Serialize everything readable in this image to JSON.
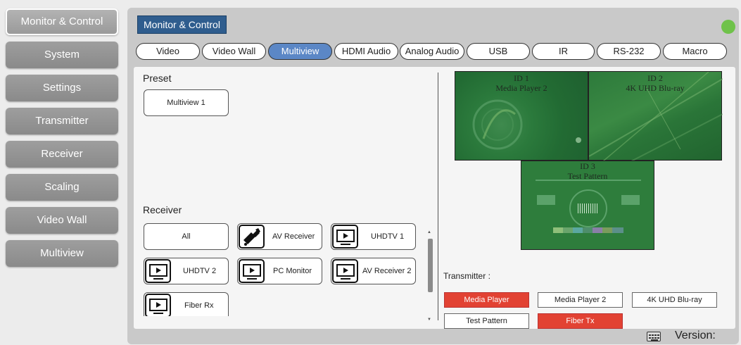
{
  "sidebar": {
    "items": [
      {
        "label": "Monitor & Control"
      },
      {
        "label": "System"
      },
      {
        "label": "Settings"
      },
      {
        "label": "Transmitter"
      },
      {
        "label": "Receiver"
      },
      {
        "label": "Scaling"
      },
      {
        "label": "Video Wall"
      },
      {
        "label": "Multiview"
      }
    ]
  },
  "header": {
    "title": "Monitor & Control",
    "status_color": "#6fc24a"
  },
  "tabs": [
    "Video",
    "Video Wall",
    "Multiview",
    "HDMI Audio",
    "Analog Audio",
    "USB",
    "IR",
    "RS-232",
    "Macro"
  ],
  "preset": {
    "label": "Preset",
    "buttons": [
      "Multiview 1"
    ]
  },
  "receiver": {
    "label": "Receiver",
    "buttons": [
      {
        "label": "All",
        "icon": ""
      },
      {
        "label": "AV Receiver",
        "icon": "receiver-icon"
      },
      {
        "label": "UHDTV 1",
        "icon": "tv-icon"
      },
      {
        "label": "UHDTV 2",
        "icon": "tv-icon"
      },
      {
        "label": "PC Monitor",
        "icon": "tv-icon"
      },
      {
        "label": "AV Receiver 2",
        "icon": "tv-icon"
      },
      {
        "label": "Fiber Rx",
        "icon": "tv-icon"
      }
    ]
  },
  "previews": [
    {
      "id": "ID 1",
      "source": "Media Player 2"
    },
    {
      "id": "ID 2",
      "source": "4K UHD Blu-ray"
    },
    {
      "id": "ID 3",
      "source": "Test Pattern"
    }
  ],
  "transmitter": {
    "label": "Transmitter :",
    "buttons": [
      {
        "label": "Media Player",
        "selected": true
      },
      {
        "label": "Media Player 2",
        "selected": false
      },
      {
        "label": "4K UHD Blu-ray",
        "selected": false
      },
      {
        "label": "Test Pattern",
        "selected": false
      },
      {
        "label": "Fiber Tx",
        "selected": true
      }
    ]
  },
  "footer": {
    "version_label": "Version:"
  },
  "colors": {
    "accent": "#5b87c6",
    "header_bg": "#2f5d8e",
    "selected_red": "#e24233",
    "preview_green": "#2e7d3c"
  }
}
